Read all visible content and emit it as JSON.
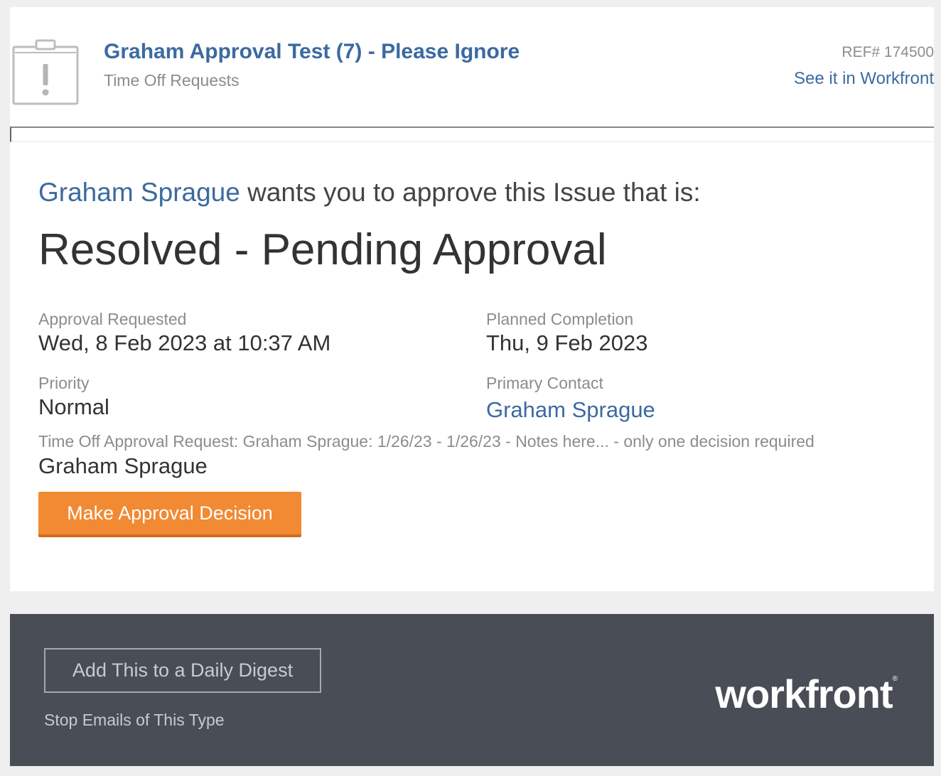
{
  "header": {
    "title": "Graham Approval Test (7) - Please Ignore",
    "subtitle": "Time Off Requests",
    "ref": "REF# 174500",
    "see_link": "See it in Workfront",
    "icon": "issue-clipboard-icon"
  },
  "request": {
    "requester": "Graham Sprague",
    "lead_text": " wants you to approve this Issue that is:",
    "status": "Resolved - Pending Approval"
  },
  "fields": {
    "approval_requested": {
      "label": "Approval Requested",
      "value": "Wed, 8 Feb 2023 at 10:37 AM"
    },
    "planned_completion": {
      "label": "Planned Completion",
      "value": "Thu, 9 Feb 2023"
    },
    "priority": {
      "label": "Priority",
      "value": "Normal"
    },
    "primary_contact": {
      "label": "Primary Contact",
      "value": "Graham Sprague"
    }
  },
  "description": {
    "label": "Time Off Approval Request: Graham Sprague: 1/26/23 - 1/26/23 - Notes here... - only one decision required",
    "value": "Graham Sprague"
  },
  "actions": {
    "approve_label": "Make Approval Decision"
  },
  "footer": {
    "digest_label": "Add This to a Daily Digest",
    "stop_label": "Stop Emails of This Type",
    "logo_text": "workfront",
    "logo_mark": "®"
  },
  "colors": {
    "link": "#3c6aa0",
    "button": "#f18a33",
    "footer_bg": "#494d55",
    "page_bg": "#efefef"
  }
}
